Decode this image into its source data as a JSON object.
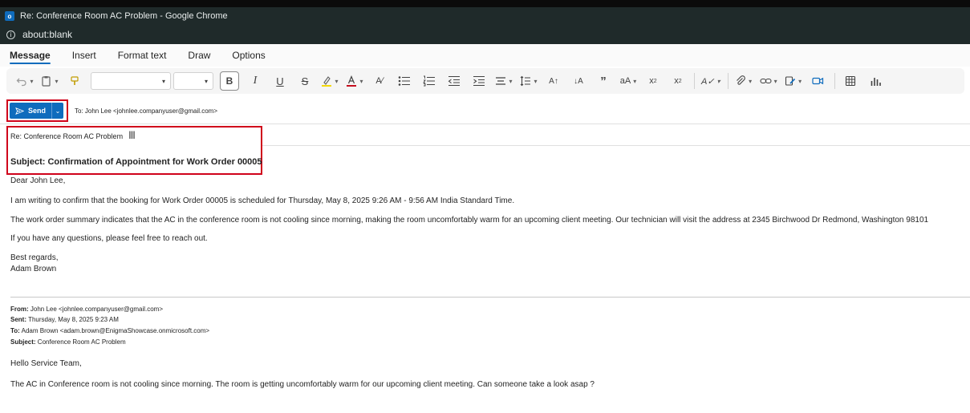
{
  "window": {
    "title": "Re: Conference Room AC Problem - Google Chrome",
    "url": "about:blank",
    "app_icon_letter": "o"
  },
  "ribbon": {
    "tabs": [
      {
        "label": "Message",
        "active": true
      },
      {
        "label": "Insert",
        "active": false
      },
      {
        "label": "Format text",
        "active": false
      },
      {
        "label": "Draw",
        "active": false
      },
      {
        "label": "Options",
        "active": false
      }
    ],
    "font_name": "",
    "font_size": "",
    "bold_label": "B",
    "italic_label": "I",
    "underline_label": "U",
    "strike_label": "S",
    "highlight_color": "#f5d90a",
    "font_color": "#c50f1f",
    "icons": [
      "undo-icon",
      "paste-icon",
      "format-painter-icon",
      "bold-icon",
      "italic-icon",
      "underline-icon",
      "strikethrough-icon",
      "highlight-icon",
      "font-color-icon",
      "clear-format-icon",
      "bullets-icon",
      "numbering-icon",
      "decrease-indent-icon",
      "increase-indent-icon",
      "align-icon",
      "line-spacing-icon",
      "styles-icon",
      "format-style-icon",
      "quote-icon",
      "change-case-icon",
      "subscript-icon",
      "superscript-icon",
      "editor-icon",
      "attach-icon",
      "link-icon",
      "signature-icon",
      "meeting-icon",
      "table-icon",
      "chart-icon"
    ]
  },
  "compose": {
    "send_label": "Send",
    "to_line": "To:  John Lee <johnlee.companyuser@gmail.com>",
    "subject_field": "Re: Conference Room AC Problem",
    "accent_color": "#0f6cbd",
    "highlight_border_color": "#d0021b"
  },
  "body": {
    "subject_line": "Subject: Confirmation of Appointment for Work Order 00005",
    "greeting": "Dear John Lee,",
    "para1": "I am writing to confirm that the booking for Work Order 00005 is scheduled for Thursday, May 8, 2025 9:26 AM - 9:56 AM India Standard Time.",
    "para2": "The work order summary indicates that the AC in the conference room is not cooling since morning, making the room uncomfortably warm for an upcoming client meeting. Our technician will visit the address at 2345 Birchwood Dr Redmond, Washington 98101",
    "para3": "If you have any questions, please feel free to reach out.",
    "closing": "Best regards,",
    "signature": "Adam Brown"
  },
  "quoted": {
    "from_label": "From:",
    "from_value": "John Lee <johnlee.companyuser@gmail.com>",
    "sent_label": "Sent:",
    "sent_value": "Thursday, May 8, 2025 9:23 AM",
    "to_label": "To:",
    "to_value": "Adam Brown <adam.brown@EnigmaShowcase.onmicrosoft.com>",
    "subject_label": "Subject:",
    "subject_value": "Conference Room AC Problem",
    "greeting": "Hello Service Team,",
    "message": "The AC in Conference room is not cooling since morning. The room is getting uncomfortably warm for our upcoming client meeting. Can someone take a look asap ?"
  }
}
